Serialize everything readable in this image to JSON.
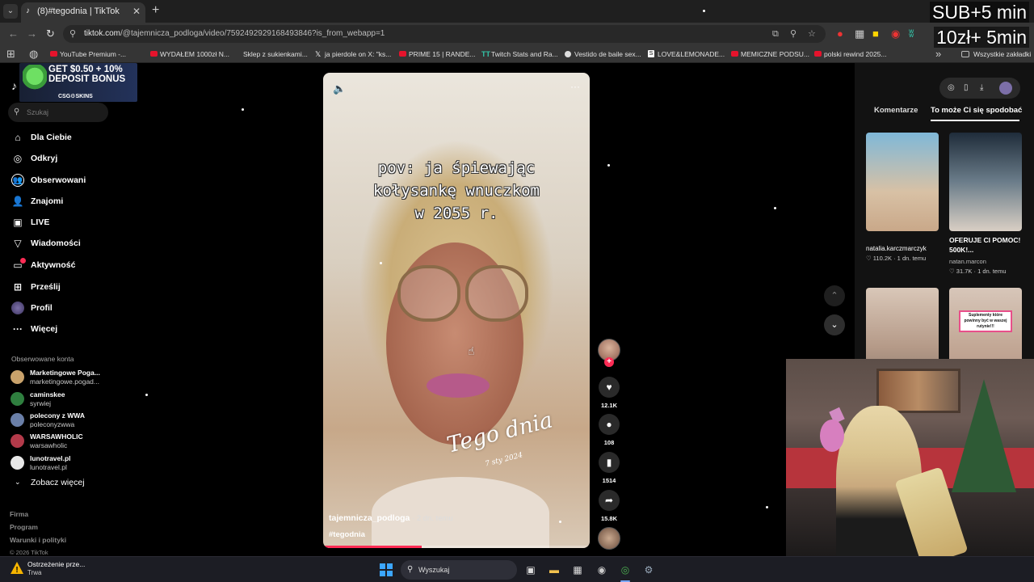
{
  "browser": {
    "tab": {
      "title": "(8)#tegodnia | TikTok",
      "close": "✕"
    },
    "new_tab": "+",
    "tab_list": "⌄",
    "url": {
      "domain": "tiktok.com",
      "path": "/@tajemnicza_podloga/video/7592492929168493846?is_from_webapp=1"
    },
    "bookmarks": [
      {
        "label": "YouTube Premium -..."
      },
      {
        "label": "WYDAŁEM 1000zł N..."
      },
      {
        "label": "Sklep z sukienkami..."
      },
      {
        "label": "ja pierdole on X: \"ks..."
      },
      {
        "label": "PRIME 15 | RANDE..."
      },
      {
        "label": "Twitch Stats and Ra..."
      },
      {
        "label": "Vestido de baile sex..."
      },
      {
        "label": "LOVE&LEMONADE..."
      },
      {
        "label": "MEMICZNE PODSU..."
      },
      {
        "label": "polski rewind 2025..."
      }
    ],
    "all_bookmarks": "Wszystkie zakładki",
    "more_bookmarks": "»"
  },
  "stream_overlay": {
    "line1": "SUB+5 min",
    "line2": "10zł+ 5min"
  },
  "ad": {
    "line1": "GET $0.50 + 10%",
    "line2": "DEPOSIT BONUS",
    "brand": "CSG⚙SKINS"
  },
  "sidebar": {
    "search_placeholder": "Szukaj",
    "nav": [
      {
        "label": "Dla Ciebie",
        "icon": "⌂"
      },
      {
        "label": "Odkryj",
        "icon": "◎"
      },
      {
        "label": "Obserwowani",
        "icon": "👥"
      },
      {
        "label": "Znajomi",
        "icon": "👤"
      },
      {
        "label": "LIVE",
        "icon": "▣"
      },
      {
        "label": "Wiadomości",
        "icon": "▽"
      },
      {
        "label": "Aktywność",
        "icon": "▭"
      },
      {
        "label": "Prześlij",
        "icon": "⊞"
      },
      {
        "label": "Profil",
        "icon": ""
      },
      {
        "label": "Więcej",
        "icon": "···"
      }
    ],
    "following_title": "Obserwowane konta",
    "following": [
      {
        "name": "Marketingowe Poga...",
        "handle": "marketingowe.pogad...",
        "color": "#c9a26b"
      },
      {
        "name": "caminskee",
        "handle": "syrwiej",
        "color": "#2f7f3f"
      },
      {
        "name": "polecony z WWA",
        "handle": "poleconyzwwa",
        "color": "#6a7fa8"
      },
      {
        "name": "WARSAWHOLIC",
        "handle": "warsawholic",
        "color": "#b33a4a"
      },
      {
        "name": "lunotravel.pl",
        "handle": "lunotravel.pl",
        "color": "#e8e8e8"
      }
    ],
    "see_more": "Zobacz więcej",
    "footer": [
      "Firma",
      "Program",
      "Warunki i polityki"
    ],
    "copyright": "© 2026 TikTok"
  },
  "video": {
    "caption": [
      "pov: ja śpiewając",
      "kołysankę wnuczkom",
      "w 2055 r."
    ],
    "script_text": "Tego dnia",
    "script_date": "7 sty 2024",
    "author": "tajemnicza_podloga",
    "posted": " · 2 dn. temu",
    "hashtag": "#tegodnia",
    "progress": 0.37
  },
  "actions": {
    "likes": "12.1K",
    "comments": "108",
    "saves": "1514",
    "shares": "15.8K"
  },
  "right_panel": {
    "tabs": [
      "Komentarze",
      "To może Ci się spodobać"
    ],
    "videos": [
      {
        "caption": "natalia.karczmarczyk",
        "stats": "♡ 110.2K · 1 dn. temu",
        "bg": "linear-gradient(180deg,#7fb8d8,#d8c1a5 60%,#c9a889)"
      },
      {
        "caption": "OFERUJE CI POMOC! 500K!...",
        "author": "natan.marcon",
        "stats": "♡ 31.7K · 1 dn. temu",
        "bg": "linear-gradient(180deg,#1f2c3a,#6b7d8a 50%,#d9cfc4)"
      },
      {
        "bg": "linear-gradient(180deg,#d9c7b8,#b59a88 60%,#8c7a6e)"
      },
      {
        "label": "Suplementy które powinny być w waszej rutynie!!!",
        "bg": "linear-gradient(180deg,#d7c6b9,#c2a795 60%,#b49486)"
      }
    ]
  },
  "taskbar": {
    "warning_title": "Ostrzeżenie prze...",
    "warning_sub": "Trwa",
    "search": "Wyszukaj"
  }
}
